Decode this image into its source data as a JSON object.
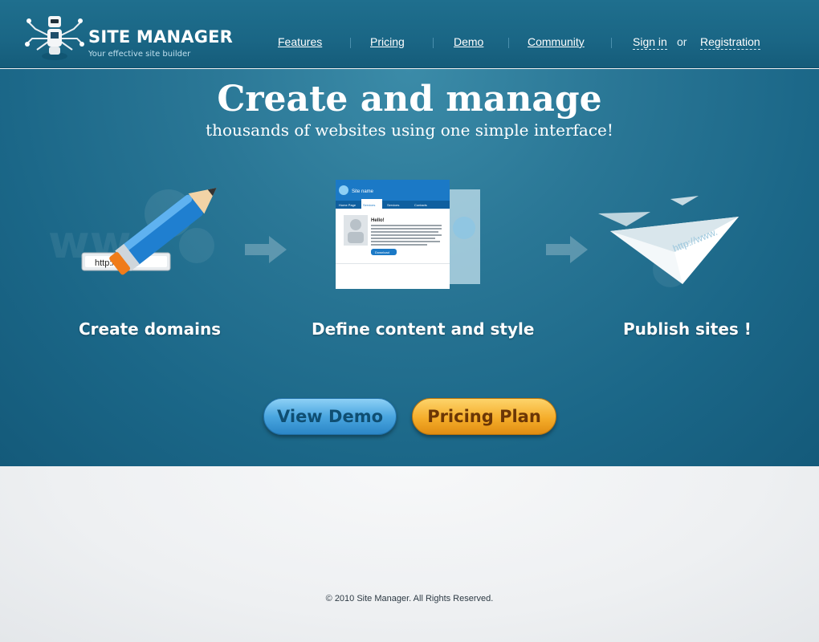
{
  "header": {
    "logo_title": "SITE MANAGER",
    "logo_tagline": "Your effective site builder"
  },
  "nav": {
    "features": "Features",
    "pricing": "Pricing",
    "demo": "Demo",
    "community": "Community",
    "sign_in": "Sign in",
    "or": "or",
    "registration": "Registration"
  },
  "hero": {
    "title": "Create and manage",
    "subtitle": "thousands of websites using one simple interface!",
    "steps": [
      {
        "label": "Create domains",
        "url_text": "http://www."
      },
      {
        "label": "Define content and style",
        "preview": {
          "site_name": "Site name",
          "tabs": [
            "Home Page",
            "Services",
            "Services",
            "Contacts"
          ],
          "heading": "Hello!",
          "button": "Download"
        }
      },
      {
        "label": "Publish sites !",
        "url_text": "http://www."
      }
    ],
    "buttons": {
      "view_demo": "View Demo",
      "pricing_plan": "Pricing Plan"
    }
  },
  "footer": {
    "copyright": "© 2010 Site Manager. All Rights Reserved."
  },
  "colors": {
    "header_bg": "#1a6685",
    "hero_bg": "#2a7796",
    "demo_button": "#4aa6e0",
    "pricing_button": "#f5ad2a"
  }
}
